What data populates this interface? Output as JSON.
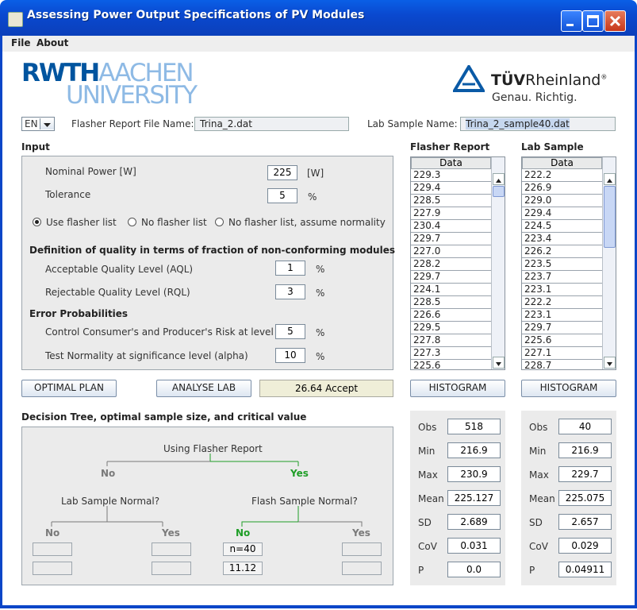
{
  "window": {
    "title": "Assessing Power Output Specifications of PV Modules"
  },
  "menu": [
    "File",
    "About"
  ],
  "logos": {
    "rwth": {
      "line1_a": "RWTH",
      "line1_b": "AACHEN",
      "line2": "UNIVERSITY"
    },
    "tuv": {
      "name_a": "TÜV",
      "name_b": "Rheinland",
      "reg": "®",
      "slogan": "Genau. Richtig."
    }
  },
  "header": {
    "language": "EN",
    "flasher_label": "Flasher Report File Name:",
    "flasher_file": "Trina_2.dat",
    "lab_label": "Lab Sample Name:",
    "lab_file": "Trina_2_sample40.dat"
  },
  "input": {
    "section_title": "Input",
    "nominal_power": {
      "label": "Nominal Power [W]",
      "value": "225",
      "unit": "[W]"
    },
    "tolerance": {
      "label": "Tolerance",
      "value": "5",
      "unit": "%"
    },
    "radios": [
      {
        "label": "Use flasher list",
        "selected": true
      },
      {
        "label": "No flasher list",
        "selected": false
      },
      {
        "label": "No flasher list, assume normality",
        "selected": false
      }
    ],
    "quality_title": "Definition of quality in terms of fraction of non-conforming modules",
    "aql": {
      "label": "Acceptable Quality Level (AQL)",
      "value": "1",
      "unit": "%"
    },
    "rql": {
      "label": "Rejectable Quality Level (RQL)",
      "value": "3",
      "unit": "%"
    },
    "error_title": "Error Probabilities",
    "risk": {
      "label": "Control Consumer's and Producer's Risk at level",
      "value": "5",
      "unit": "%"
    },
    "normality": {
      "label": "Test Normality at significance level (alpha)",
      "value": "10",
      "unit": "%"
    }
  },
  "actions": {
    "optimal_plan": "OPTIMAL PLAN",
    "analyse_lab": "ANALYSE LAB",
    "result": "26.64 Accept",
    "histogram": "HISTOGRAM"
  },
  "flasher": {
    "title": "Flasher Report",
    "column": "Data",
    "rows": [
      "229.3",
      "229.4",
      "228.5",
      "227.9",
      "230.4",
      "229.7",
      "227.0",
      "228.2",
      "229.7",
      "224.1",
      "228.5",
      "226.6",
      "229.5",
      "227.8",
      "227.3",
      "225.6"
    ],
    "stats": {
      "Obs": "518",
      "Min": "216.9",
      "Max": "230.9",
      "Mean": "225.127",
      "SD": "2.689",
      "CoV": "0.031",
      "P": "0.0"
    }
  },
  "lab": {
    "title": "Lab Sample",
    "column": "Data",
    "rows": [
      "222.2",
      "226.9",
      "229.0",
      "229.4",
      "224.5",
      "223.4",
      "226.2",
      "223.5",
      "223.7",
      "223.1",
      "222.2",
      "223.1",
      "229.7",
      "225.6",
      "227.1",
      "228.7"
    ],
    "stats": {
      "Obs": "40",
      "Min": "216.9",
      "Max": "229.7",
      "Mean": "225.075",
      "SD": "2.657",
      "CoV": "0.029",
      "P": "0.04911"
    }
  },
  "tree": {
    "title": "Decision Tree, optimal sample size, and critical value",
    "root": "Using Flasher Report",
    "no": "No",
    "yes": "Yes",
    "lab_normal": "Lab Sample Normal?",
    "flash_normal": "Flash Sample Normal?",
    "sample_size": "n=40",
    "critical_value": "11.12"
  },
  "stat_labels": [
    "Obs",
    "Min",
    "Max",
    "Mean",
    "SD",
    "CoV",
    "P"
  ],
  "colors": {
    "title_bar": "#0a49d0",
    "rwth_blue": "#00549f",
    "tuv_blue": "#0a5aa6",
    "active_path": "#1f9e27",
    "inactive_path": "#7a7a7a"
  }
}
